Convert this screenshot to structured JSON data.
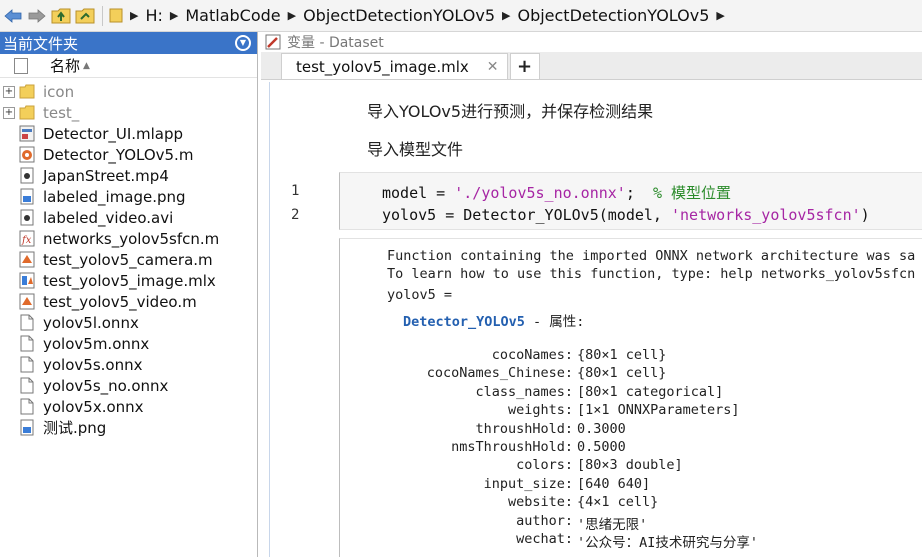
{
  "breadcrumb": [
    "H:",
    "MatlabCode",
    "ObjectDetectionYOLOv5",
    "ObjectDetectionYOLOv5"
  ],
  "left_panel": {
    "title": "当前文件夹",
    "column_name": "名称",
    "files": [
      {
        "name": "icon",
        "type": "folder"
      },
      {
        "name": "test_",
        "type": "folder"
      },
      {
        "name": "Detector_UI.mlapp",
        "type": "mlapp"
      },
      {
        "name": "Detector_YOLOv5.m",
        "type": "class"
      },
      {
        "name": "JapanStreet.mp4",
        "type": "video"
      },
      {
        "name": "labeled_image.png",
        "type": "image"
      },
      {
        "name": "labeled_video.avi",
        "type": "video"
      },
      {
        "name": "networks_yolov5sfcn.m",
        "type": "function"
      },
      {
        "name": "test_yolov5_camera.m",
        "type": "script"
      },
      {
        "name": "test_yolov5_image.mlx",
        "type": "livescript"
      },
      {
        "name": "test_yolov5_video.m",
        "type": "script"
      },
      {
        "name": "yolov5l.onnx",
        "type": "file"
      },
      {
        "name": "yolov5m.onnx",
        "type": "file"
      },
      {
        "name": "yolov5s.onnx",
        "type": "file"
      },
      {
        "name": "yolov5s_no.onnx",
        "type": "file"
      },
      {
        "name": "yolov5x.onnx",
        "type": "file"
      },
      {
        "name": "测试.png",
        "type": "image"
      }
    ]
  },
  "editor": {
    "variable_title": "变量 - Dataset",
    "tab_label": "test_yolov5_image.mlx",
    "tab_close": "✕",
    "tab_add": "+",
    "heading1": "导入YOLOv5进行预测，并保存检测结果",
    "heading2": "导入模型文件",
    "line_numbers": [
      "1",
      "2"
    ],
    "code": {
      "l1_a": "model = ",
      "l1_str": "'./yolov5s_no.onnx'",
      "l1_b": ";  ",
      "l1_cmt": "% 模型位置",
      "l2_a": "yolov5 = Detector_YOLOv5(model, ",
      "l2_str": "'networks_yolov5sfcn'",
      "l2_b": ")"
    },
    "output": {
      "line1": "Function containing the imported ONNX network architecture was sa",
      "line2": "To learn how to use this function, type: help networks_yolov5sfcn",
      "line3": "yolov5 = ",
      "class_name": "Detector_YOLOv5",
      "class_suffix": " - 属性:",
      "properties": [
        {
          "key": "cocoNames:",
          "value": "{80×1 cell}"
        },
        {
          "key": "cocoNames_Chinese:",
          "value": "{80×1 cell}"
        },
        {
          "key": "class_names:",
          "value": "[80×1 categorical]"
        },
        {
          "key": "weights:",
          "value": "[1×1 ONNXParameters]"
        },
        {
          "key": "throushHold:",
          "value": "0.3000"
        },
        {
          "key": "nmsThroushHold:",
          "value": "0.5000"
        },
        {
          "key": "colors:",
          "value": "[80×3 double]"
        },
        {
          "key": "input_size:",
          "value": "[640 640]"
        },
        {
          "key": "website:",
          "value": "{4×1 cell}"
        },
        {
          "key": "author:",
          "value": "'思绪无限'"
        },
        {
          "key": "wechat:",
          "value": "'公众号：AI技术研究与分享'"
        }
      ]
    }
  },
  "colors": {
    "panel_header": "#3a74c8",
    "string": "#a626a4",
    "comment": "#2c8c2c",
    "class_link": "#2460b0"
  }
}
